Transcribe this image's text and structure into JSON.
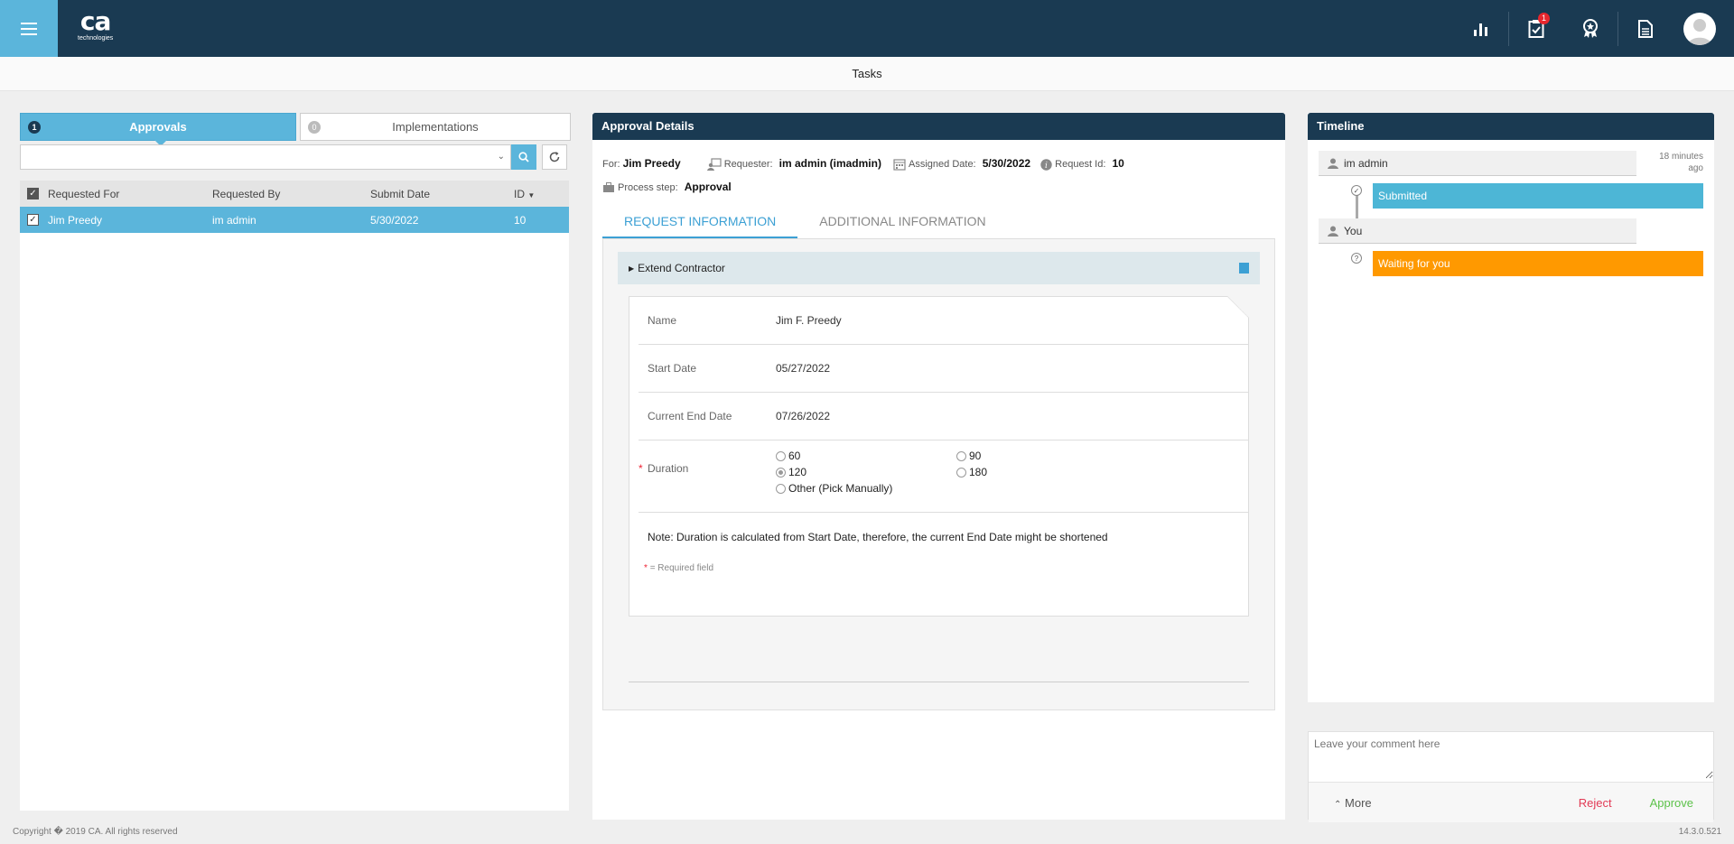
{
  "topbar": {
    "logo_main": "ca",
    "logo_sub": "technologies",
    "tasks_badge": "1"
  },
  "subheader": {
    "title": "Tasks"
  },
  "left": {
    "tabs": [
      {
        "count": "1",
        "label": "Approvals"
      },
      {
        "count": "0",
        "label": "Implementations"
      }
    ],
    "search": {
      "value": ""
    },
    "columns": [
      "Requested For",
      "Requested By",
      "Submit Date",
      "ID"
    ],
    "rows": [
      {
        "requested_for": "Jim Preedy",
        "requested_by": "im admin",
        "submit_date": "5/30/2022",
        "id": "10"
      }
    ]
  },
  "details": {
    "title": "Approval Details",
    "for_label": "For:",
    "for_value": "Jim Preedy",
    "requester_label": "Requester:",
    "requester_value": "im admin (imadmin)",
    "assigned_label": "Assigned Date:",
    "assigned_value": "5/30/2022",
    "request_id_label": "Request Id:",
    "request_id_value": "10",
    "process_label": "Process step:",
    "process_value": "Approval",
    "tabs": [
      "REQUEST INFORMATION",
      "ADDITIONAL INFORMATION"
    ],
    "section": "Extend Contractor",
    "fields": {
      "name_label": "Name",
      "name_value": "Jim F. Preedy",
      "start_label": "Start Date",
      "start_value": "05/27/2022",
      "end_label": "Current End Date",
      "end_value": "07/26/2022",
      "duration_label": "Duration"
    },
    "duration_options": [
      "60",
      "90",
      "120",
      "180",
      "Other (Pick Manually)"
    ],
    "duration_selected": "120",
    "note": "Note: Duration is calculated from Start Date, therefore, the current End Date might be shortened",
    "required_note": "= Required field"
  },
  "timeline": {
    "title": "Timeline",
    "entries": [
      {
        "user": "im admin",
        "status": "Submitted",
        "time": "18 minutes ago",
        "color": "#4db6d6"
      },
      {
        "user": "You",
        "status": "Waiting for you",
        "color": "#ff9900"
      }
    ],
    "time_line1": "18 minutes",
    "time_line2": "ago"
  },
  "comment": {
    "placeholder": "Leave your comment here",
    "more": "More",
    "reject": "Reject",
    "approve": "Approve"
  },
  "footer": {
    "copyright": "Copyright � 2019 CA. All rights reserved",
    "version": "14.3.0.521"
  }
}
